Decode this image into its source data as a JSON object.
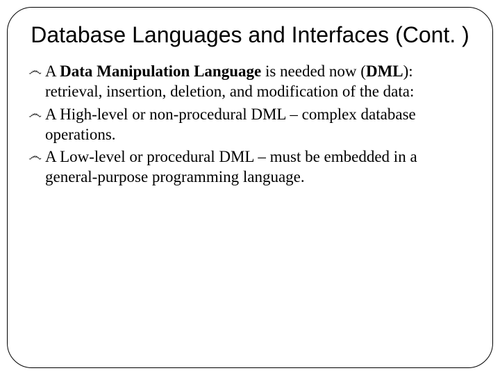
{
  "title": "Database Languages and Interfaces (Cont. )",
  "bullets": [
    {
      "lead": "A ",
      "bold": "Data Manipulation Language",
      "mid": " is needed now (",
      "bold2": "DML",
      "rest": "): retrieval, insertion, deletion, and modification of the data:"
    },
    {
      "lead": "A High-level or non-procedural DML – complex database operations.",
      "bold": "",
      "mid": "",
      "bold2": "",
      "rest": ""
    },
    {
      "lead": "A Low-level or procedural DML – must be embedded in a general-purpose programming language.",
      "bold": "",
      "mid": "",
      "bold2": "",
      "rest": ""
    }
  ],
  "bullet_glyph": "෴"
}
